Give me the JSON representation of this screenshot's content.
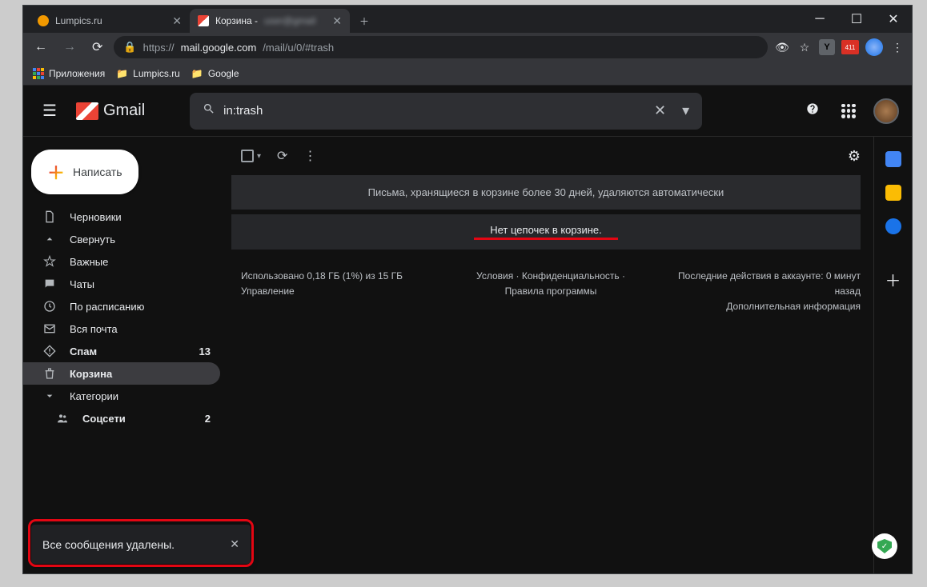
{
  "browser": {
    "tabs": [
      {
        "title": "Lumpics.ru"
      },
      {
        "title": "Корзина - ",
        "suffix_hidden": "user@gmail"
      }
    ],
    "url_prefix": "https://",
    "url_host": "mail.google.com",
    "url_path": "/mail/u/0/#trash",
    "ext_badge": "411",
    "bookmarks": {
      "apps": "Приложения",
      "b1": "Lumpics.ru",
      "b2": "Google"
    }
  },
  "header": {
    "logo": "Gmail",
    "search_value": "in:trash"
  },
  "compose": "Написать",
  "sidebar": {
    "items": [
      {
        "icon": "file",
        "label": "Черновики",
        "count": ""
      },
      {
        "icon": "chevron-up",
        "label": "Свернуть",
        "count": ""
      },
      {
        "icon": "star",
        "label": "Важные",
        "count": ""
      },
      {
        "icon": "chat",
        "label": "Чаты",
        "count": ""
      },
      {
        "icon": "clock",
        "label": "По расписанию",
        "count": ""
      },
      {
        "icon": "mail",
        "label": "Вся почта",
        "count": ""
      },
      {
        "icon": "spam",
        "label": "Спам",
        "count": "13",
        "bold": true
      },
      {
        "icon": "trash",
        "label": "Корзина",
        "count": "",
        "active": true
      },
      {
        "icon": "caret",
        "label": "Категории",
        "count": ""
      },
      {
        "icon": "people",
        "label": "Соцсети",
        "count": "2",
        "bold": true,
        "indent": true
      }
    ]
  },
  "main": {
    "banner": "Письма, хранящиеся в корзине более 30 дней, удаляются автоматически",
    "empty": "Нет цепочек в корзине."
  },
  "footer": {
    "storage1": "Использовано 0,18 ГБ (1%) из 15 ГБ",
    "storage2": "Управление",
    "terms": "Условия · Конфиденциальность · Правила программы",
    "activity1": "Последние действия в аккаунте: 0 минут назад",
    "activity2": "Дополнительная информация"
  },
  "toast": "Все сообщения удалены."
}
